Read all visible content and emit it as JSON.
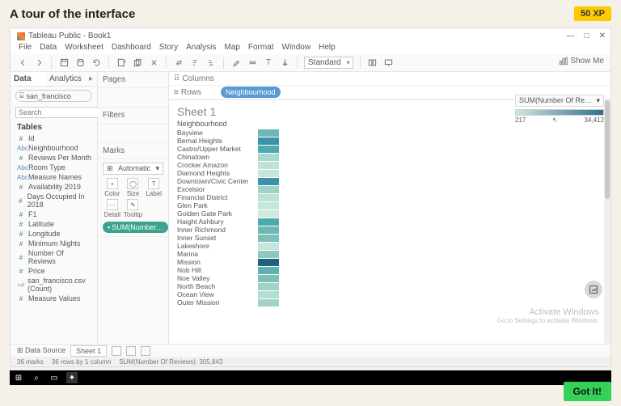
{
  "lesson": {
    "title": "A tour of the interface",
    "xp": "50 XP",
    "got_it": "Got It!"
  },
  "window": {
    "title": "Tableau Public - Book1"
  },
  "menu": [
    "File",
    "Data",
    "Worksheet",
    "Dashboard",
    "Story",
    "Analysis",
    "Map",
    "Format",
    "Window",
    "Help"
  ],
  "toolbar": {
    "standard": "Standard",
    "show_me": "Show Me"
  },
  "side": {
    "tabs": {
      "data": "Data",
      "analytics": "Analytics"
    },
    "datasource": "san_francisco",
    "search_placeholder": "Search",
    "tables_label": "Tables"
  },
  "fields": [
    {
      "type": "num",
      "name": "Id"
    },
    {
      "type": "str",
      "name": "Neighbourhood"
    },
    {
      "type": "num",
      "name": "Reviews Per Month"
    },
    {
      "type": "str",
      "name": "Room Type"
    },
    {
      "type": "str",
      "name": "Measure Names"
    },
    {
      "type": "num",
      "name": "Availability 2019"
    },
    {
      "type": "num",
      "name": "Days Occupied In 2018"
    },
    {
      "type": "num",
      "name": "F1"
    },
    {
      "type": "num",
      "name": "Latitude"
    },
    {
      "type": "num",
      "name": "Longitude"
    },
    {
      "type": "num",
      "name": "Minimum Nights"
    },
    {
      "type": "num",
      "name": "Number Of Reviews"
    },
    {
      "type": "num",
      "name": "Price"
    },
    {
      "type": "calc",
      "name": "san_francisco.csv (Count)"
    },
    {
      "type": "num",
      "name": "Measure Values"
    }
  ],
  "panels": {
    "pages": "Pages",
    "filters": "Filters",
    "marks": "Marks",
    "marks_type": "Automatic"
  },
  "marks_cells": [
    {
      "label": "Color"
    },
    {
      "label": "Size"
    },
    {
      "label": "Label"
    },
    {
      "label": "Detail"
    },
    {
      "label": "Tooltip"
    }
  ],
  "marks_pill": "SUM(Number…",
  "shelves": {
    "columns": "Columns",
    "rows": "Rows",
    "rows_pill": "Neighbourhood"
  },
  "sheet": {
    "title": "Sheet 1",
    "header": "Neighbourhood"
  },
  "rows": [
    {
      "name": "Bayview",
      "c": "#6fb7b3"
    },
    {
      "name": "Bernal Heights",
      "c": "#3a93a8"
    },
    {
      "name": "Castro/Upper Market",
      "c": "#4ea9b0"
    },
    {
      "name": "Chinatown",
      "c": "#a9d8cd"
    },
    {
      "name": "Crocker Amazon",
      "c": "#bfe2d8"
    },
    {
      "name": "Diamond Heights",
      "c": "#c6e5dc"
    },
    {
      "name": "Downtown/Civic Center",
      "c": "#3a93a8"
    },
    {
      "name": "Excelsior",
      "c": "#9fd2c8"
    },
    {
      "name": "Financial District",
      "c": "#bde1d7"
    },
    {
      "name": "Glen Park",
      "c": "#c6e5dc"
    },
    {
      "name": "Golden Gate Park",
      "c": "#cfe9e0"
    },
    {
      "name": "Haight Ashbury",
      "c": "#4ea9b0"
    },
    {
      "name": "Inner Richmond",
      "c": "#6fb7b3"
    },
    {
      "name": "Inner Sunset",
      "c": "#7dc0ba"
    },
    {
      "name": "Lakeshore",
      "c": "#c6e5dc"
    },
    {
      "name": "Marina",
      "c": "#8dc9c1"
    },
    {
      "name": "Mission",
      "c": "#20627f"
    },
    {
      "name": "Nob Hill",
      "c": "#5eb1ae"
    },
    {
      "name": "Noe Valley",
      "c": "#7dc0ba"
    },
    {
      "name": "North Beach",
      "c": "#9fd2c8"
    },
    {
      "name": "Ocean View",
      "c": "#b4ddd3"
    },
    {
      "name": "Outer Mission",
      "c": "#9fd2c8"
    }
  ],
  "legend": {
    "title": "SUM(Number Of Re…",
    "min": "217",
    "max": "34,412"
  },
  "tabs": {
    "data_source": "Data Source",
    "sheet1": "Sheet 1"
  },
  "status": {
    "marks": "36 marks",
    "rows": "36 rows by 1 column",
    "sum": "SUM(Number Of Reviews): 305,843"
  },
  "watermark": {
    "line1": "Activate Windows",
    "line2": "Go to Settings to activate Windows."
  }
}
